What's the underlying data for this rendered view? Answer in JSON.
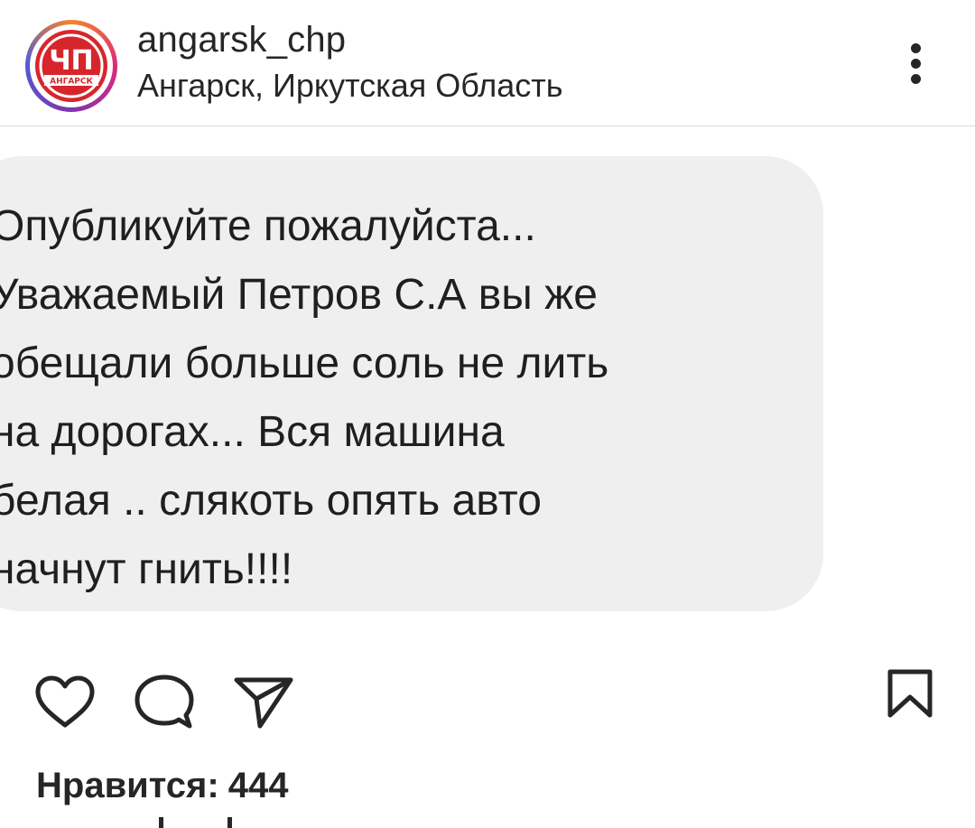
{
  "header": {
    "username": "angarsk_chp",
    "location": "Ангарск, Иркутская Область",
    "avatar_logo_text": "ЧП",
    "avatar_logo_subtext": "АНГАРСК"
  },
  "post": {
    "comment_lines": [
      "Опубликуйте пожалуйста...",
      "Уважаемый Петров С.А вы же",
      "обещали больше соль не лить",
      "на дорогах... Вся машина",
      "белая .. слякоть опять авто",
      "начнут гнить!!!!"
    ]
  },
  "actions": {
    "icons": [
      "heart-icon",
      "comment-icon",
      "share-icon",
      "bookmark-icon"
    ]
  },
  "likes": {
    "label": "Нравится:",
    "count": "444"
  },
  "colors": {
    "text": "#262626",
    "bubble": "#efefef",
    "divider": "#dbdbdb",
    "logo_red": "#d7262b"
  }
}
